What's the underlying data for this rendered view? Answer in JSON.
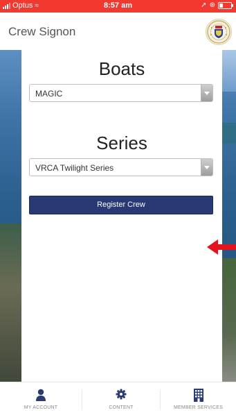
{
  "status_bar": {
    "carrier": "Optus",
    "time": "8:57 am"
  },
  "header": {
    "title": "Crew Signon",
    "logo_text": "ROYAL GEELONG YACHT CLUB"
  },
  "boats": {
    "heading": "Boats",
    "selected": "MAGIC"
  },
  "series": {
    "heading": "Series",
    "selected": "VRCA Twilight Series"
  },
  "register_button": "Register Crew",
  "tabs": [
    {
      "label": "MY ACCOUNT",
      "icon": "user-icon"
    },
    {
      "label": "CONTENT",
      "icon": "gear-icon"
    },
    {
      "label": "MEMBER SERVICES",
      "icon": "building-icon"
    }
  ],
  "colors": {
    "status_bar": "#f2392f",
    "button": "#283974",
    "icon": "#2c3a73",
    "arrow": "#e3141b"
  }
}
